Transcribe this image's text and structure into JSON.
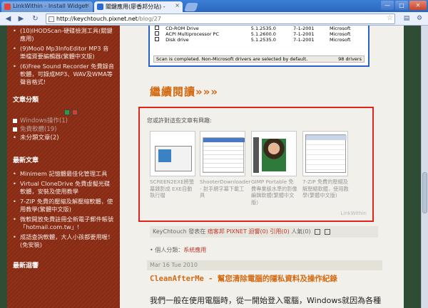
{
  "browser": {
    "tabs": [
      {
        "label": "LinkWithin - Install Widget",
        "active": false
      },
      {
        "label": "關鍵應用(廖香邦分站) - ",
        "active": true
      }
    ],
    "url_host": "http://keychtouch.pixnet.net",
    "url_path": "/blog/27",
    "window_buttons": [
      "—",
      "□",
      "✕"
    ]
  },
  "sidebar": {
    "top_items": [
      {
        "bullet": "•",
        "text": "(10)IHODScan-硬碟檢測工具(關鍵應用)"
      },
      {
        "bullet": "•",
        "text": "(9)Moo0 Mp3InfoEditor MP3 音樂檔資要編輯器(繁體中文版)"
      },
      {
        "bullet": "•",
        "text": "(6)Free Sound Recorder 免費錄音軟體，可錄成MP3、WAV及WMA等聲音格式!"
      }
    ],
    "categories_heading": "文章分類",
    "categories": [
      {
        "name": "Windows操作",
        "count": "(1)",
        "dim": true
      },
      {
        "name": "免費軟體",
        "count": "(19)",
        "dim": true
      },
      {
        "name": "未分類文章",
        "count": "(2)",
        "dim": false
      }
    ],
    "latest_heading": "最新文章",
    "latest": [
      {
        "bullet": "•",
        "text": "Minimem 記憶體最佳化管理工具"
      },
      {
        "bullet": "•",
        "text": "Virtual CloneDrive 免費虛擬光碟軟體，安裝及使用教學"
      },
      {
        "bullet": "•",
        "text": "7-ZIP 免費的壓縮及解壓縮軟體，使用教學(繁體中文版)"
      },
      {
        "bullet": "•",
        "text": "微軟開放免費註冊全新電子郵件帳號「hotmail.com.tw」!"
      },
      {
        "bullet": "•",
        "text": "成語查詢軟體，大人小孩都要用喔！(免安裝)"
      }
    ],
    "bottom_heading": "最新迴響"
  },
  "screenshot_table": {
    "rows": [
      [
        "CD-ROM Drive",
        "5.1.2535.0",
        "7-1-2001",
        "Microsoft"
      ],
      [
        "ACPI Multiprocessor PC",
        "5.1.2600.0",
        "7-1-2001",
        "Microsoft"
      ],
      [
        "Disk drive",
        "5.1.2535.0",
        "7-1-2001",
        "Microsoft"
      ]
    ],
    "status_left": "Scan is completed. Non-Microsoft drivers are selected by default.",
    "status_right": "98 drivers"
  },
  "main": {
    "continue_label": "繼續閱讀»»»",
    "related_title": "您或許對這些文章有興趣:",
    "related": [
      {
        "text": "SCREEN2EXE將螢幕錄影成 EXE自動執行檔"
      },
      {
        "text": "ShooterDownloader - 射手網字幕下載工具"
      },
      {
        "text": "GIMP Portable 免費專業級水準的影像編輯軟體(繁體中文版)"
      },
      {
        "text": "7-ZIP 免費的壓縮及解壓縮軟體，使用教學(繁體中文版)"
      }
    ],
    "linkwithin": "LinkWithin",
    "meta": {
      "author": "KeyChtouch",
      "posted_in": "發表在",
      "site": "痞客邦 PIXNET",
      "comments": "迴響(0)",
      "trackback": "引用(0)",
      "views": "人氣(0)"
    },
    "personal_label": "• 個人分類：",
    "personal_category": "系統應用",
    "date": "Mar 16 Tue 2010",
    "post_title": "CleanAfterMe - 幫您清除電腦的隱私資料及操作紀錄",
    "body_first_line": "我們一般在使用電腦時，從一開始登入電腦，Windows就因為各種"
  }
}
